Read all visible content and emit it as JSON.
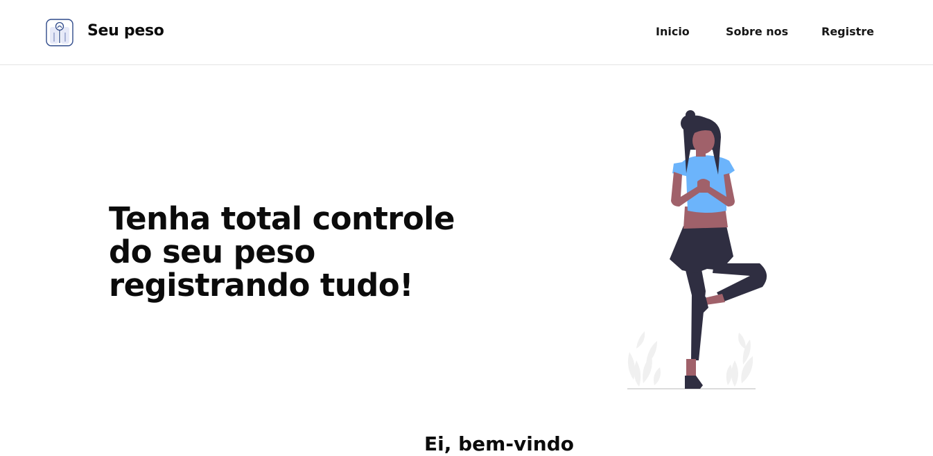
{
  "header": {
    "brand": "Seu peso",
    "nav": [
      {
        "label": "Inicio"
      },
      {
        "label": "Sobre nos"
      },
      {
        "label": "Registre"
      }
    ]
  },
  "hero": {
    "title_lines": [
      "Tenha total controle",
      "do seu peso",
      "registrando tudo!"
    ]
  },
  "next_section": {
    "title": "Ei, bem-vindo"
  },
  "colors": {
    "accent_blue": "#6cb4fb",
    "dark_navy": "#2f2e41",
    "skin": "#a0616a",
    "leaf_gray": "#f0f0f0",
    "logo_blue": "#2f4a8a"
  },
  "icons": {
    "logo": "scale-icon"
  }
}
